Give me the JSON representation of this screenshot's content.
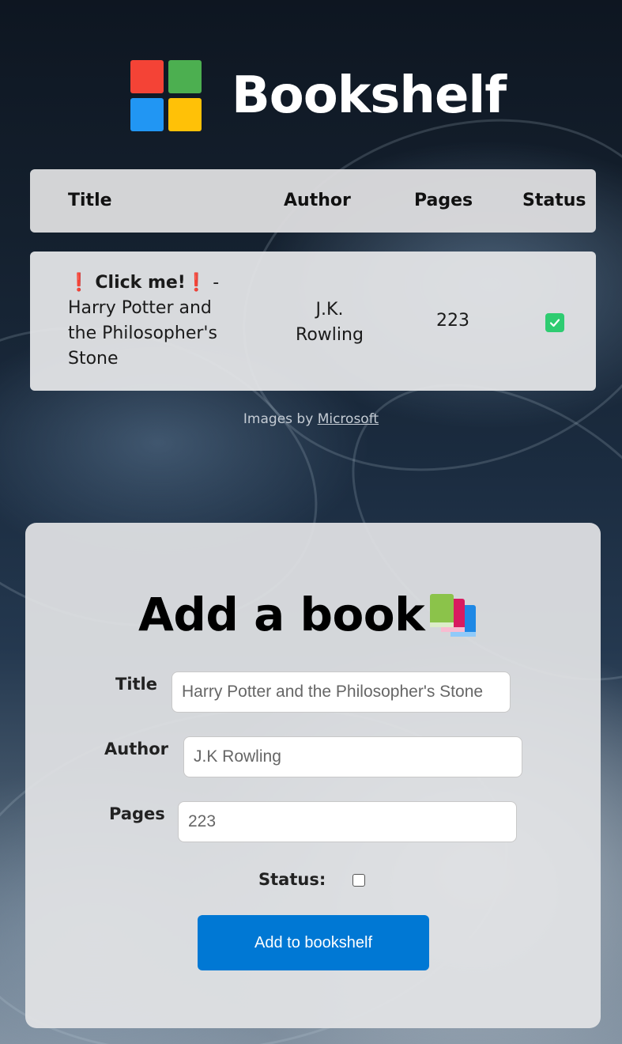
{
  "app": {
    "title": "Bookshelf"
  },
  "table": {
    "headers": [
      "Title",
      "Author",
      "Pages",
      "Status"
    ],
    "rows": [
      {
        "title_prefix_emoji": "❗",
        "click_text": "Click me!",
        "title_suffix_emoji": "❗",
        "title_separator": " - ",
        "title": "Harry Potter and the Philosopher's Stone",
        "author": "J.K. Rowling",
        "pages": "223",
        "status": true
      }
    ]
  },
  "credits": {
    "prefix": "Images by ",
    "link_text": "Microsoft"
  },
  "form": {
    "heading": "Add a book",
    "heading_icon": "books-icon",
    "title_label": "Title",
    "title_placeholder": "Harry Potter and the Philosopher's Stone",
    "author_label": "Author",
    "author_placeholder": "J.K Rowling",
    "pages_label": "Pages",
    "pages_placeholder": "223",
    "status_label": "Status:",
    "status_checked": false,
    "submit_label": "Add to bookshelf"
  },
  "colors": {
    "logo_red": "#f44336",
    "logo_green": "#4caf50",
    "logo_blue": "#2196f3",
    "logo_yellow": "#ffc107",
    "status_checked": "#2ecc71",
    "button": "#0078d4"
  }
}
